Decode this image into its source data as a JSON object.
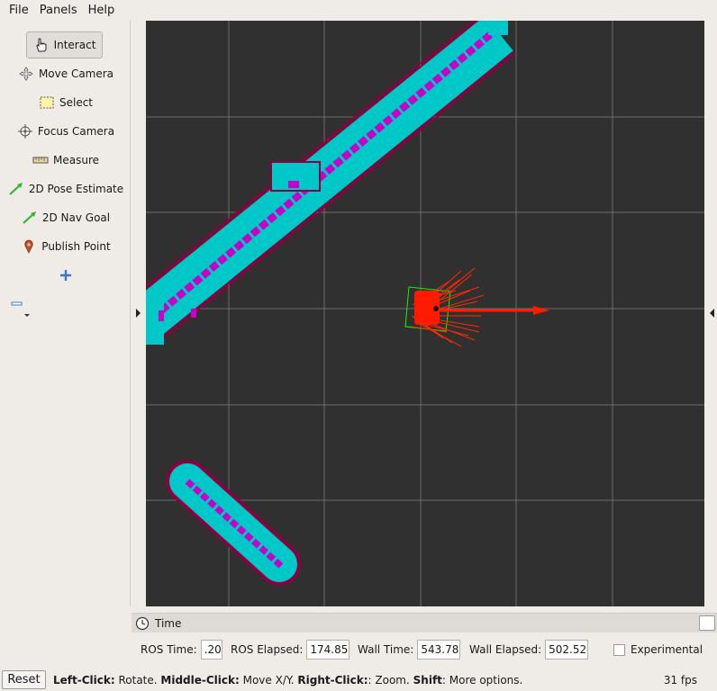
{
  "menubar": {
    "file": "File",
    "panels": "Panels",
    "help": "Help"
  },
  "tools": {
    "interact": "Interact",
    "move_camera": "Move Camera",
    "select": "Select",
    "focus_camera": "Focus Camera",
    "measure": "Measure",
    "pose_estimate": "2D Pose Estimate",
    "nav_goal": "2D Nav Goal",
    "publish_point": "Publish Point"
  },
  "time_panel": {
    "title": "Time",
    "ros_time_label": "ROS Time:",
    "ros_time_value": ".20",
    "ros_elapsed_label": "ROS Elapsed:",
    "ros_elapsed_value": "174.85",
    "wall_time_label": "Wall Time:",
    "wall_time_value": "543.78",
    "wall_elapsed_label": "Wall Elapsed:",
    "wall_elapsed_value": "502.52",
    "experimental_label": "Experimental",
    "experimental_checked": false
  },
  "status": {
    "reset": "Reset",
    "left_click": "Left-Click:",
    "left_desc": " Rotate. ",
    "middle_click": "Middle-Click:",
    "middle_desc": " Move X/Y. ",
    "right_click": "Right-Click:",
    "right_desc": ": Zoom. ",
    "shift": "Shift",
    "shift_desc": ": More options.",
    "fps": "31 fps"
  },
  "colors": {
    "background": "#303030",
    "grid": "#a0a0a0",
    "costmap_inflation": "#00c8c8",
    "costmap_lethal": "#c800c8",
    "costmap_edge": "#8c0040",
    "particles": "#ff0000",
    "footprint": "#00ff00"
  }
}
